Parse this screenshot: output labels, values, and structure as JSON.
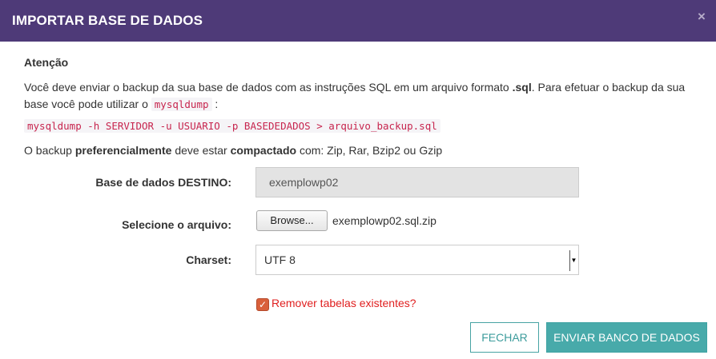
{
  "modal": {
    "title": "IMPORTAR BASE DE DADOS",
    "close_icon": "close-icon",
    "close_glyph": "×"
  },
  "body": {
    "attention": "Atenção",
    "para1_a": "Você deve enviar o backup da sua base de dados com as instruções SQL em um arquivo formato ",
    "para1_b": ".sql",
    "para1_c": ". Para efetuar o backup da sua base você pode utilizar o ",
    "para1_code": "mysqldump",
    "para1_d": " :",
    "command": "mysqldump -h SERVIDOR -u USUARIO -p BASEDEDADOS > arquivo_backup.sql",
    "para2_a": "O backup ",
    "para2_b": "preferencialmente",
    "para2_c": " deve estar ",
    "para2_d": "compactado",
    "para2_e": " com: Zip, Rar, Bzip2 ou Gzip"
  },
  "form": {
    "dest_label": "Base de dados DESTINO:",
    "dest_value": "exemplowp02",
    "file_label": "Selecione o arquivo:",
    "browse_label": "Browse...",
    "file_name": "exemplowp02.sql.zip",
    "charset_label": "Charset:",
    "charset_value": "UTF 8",
    "drop_tables_label": "Remover tabelas existentes?",
    "drop_tables_checked": true
  },
  "footer": {
    "close_label": "FECHAR",
    "send_label": "ENVIAR BANCO DE DADOS"
  },
  "colors": {
    "header": "#4e3a78",
    "accent": "#48aaaa",
    "checkbox": "#d9603b",
    "warning_text": "#e02020"
  }
}
